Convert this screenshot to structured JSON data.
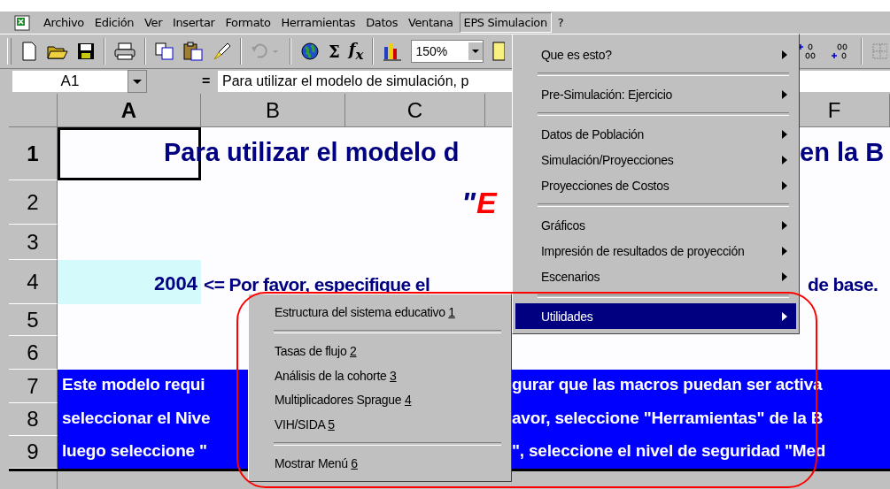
{
  "menu_bar": {
    "items": [
      {
        "label": "Archivo",
        "selected": false
      },
      {
        "label": "Edición",
        "selected": false
      },
      {
        "label": "Ver",
        "selected": false
      },
      {
        "label": "Insertar",
        "selected": false
      },
      {
        "label": "Formato",
        "selected": false
      },
      {
        "label": "Herramientas",
        "selected": false
      },
      {
        "label": "Datos",
        "selected": false
      },
      {
        "label": "Ventana",
        "selected": false
      },
      {
        "label": "EPS Simulacion",
        "selected": true
      },
      {
        "label": "?",
        "selected": false
      }
    ]
  },
  "toolbar": {
    "glyphs": [
      "Σ",
      "f$_{x}$"
    ],
    "zoom": "150%"
  },
  "formula_bar": {
    "name_box": "A1",
    "equals": "=",
    "formula": "Para utilizar el modelo de simulación, p"
  },
  "sheet": {
    "columns": [
      {
        "label": "A",
        "selected": true
      },
      {
        "label": "B",
        "selected": false
      },
      {
        "label": "C",
        "selected": false
      },
      {
        "label": "F",
        "selected": false
      }
    ],
    "rows": [
      {
        "number": "1",
        "selected": true,
        "kind": "title",
        "fragments": [
          {
            "text": "Para utilizar el modelo d",
            "color": "#000080"
          },
          {
            "text": "en la B",
            "color": "#000080"
          }
        ]
      },
      {
        "number": "2",
        "selected": false,
        "kind": "subtitle",
        "fragments": [
          {
            "text": "\"",
            "color": "#000080"
          },
          {
            "text": "E",
            "color": "#ff0000"
          }
        ]
      },
      {
        "number": "3",
        "selected": false,
        "kind": "blank"
      },
      {
        "number": "4",
        "selected": false,
        "kind": "input",
        "value": "2004",
        "fragments": [
          {
            "text": "<= Por favor, especifique el",
            "color": "#000080"
          },
          {
            "text": "de base.",
            "color": "#000080"
          }
        ]
      },
      {
        "number": "5",
        "selected": false,
        "kind": "blank"
      },
      {
        "number": "6",
        "selected": false,
        "kind": "blank"
      },
      {
        "number": "7",
        "selected": false,
        "kind": "banner",
        "fragments": [
          {
            "text": "Este modelo requi",
            "color": "#ffffff"
          },
          {
            "text": "gurar que las macros puedan ser activa",
            "color": "#ffffff"
          }
        ]
      },
      {
        "number": "8",
        "selected": false,
        "kind": "banner",
        "fragments": [
          {
            "text": "seleccionar el Nive",
            "color": "#ffffff"
          },
          {
            "text": "avor, seleccione \"Herramientas\" de la B",
            "color": "#ffffff"
          }
        ]
      },
      {
        "number": "9",
        "selected": false,
        "kind": "banner",
        "fragments": [
          {
            "text": "luego seleccione \"",
            "color": "#ffffff"
          },
          {
            "text": "\", seleccione el nivel de seguridad \"Med",
            "color": "#ffffff"
          }
        ]
      }
    ]
  },
  "menu": {
    "items": [
      {
        "kind": "item",
        "label": "Que es esto?",
        "selected": false
      },
      {
        "kind": "separator"
      },
      {
        "kind": "item",
        "label": "Pre-Simulación: Ejercicio",
        "selected": false
      },
      {
        "kind": "separator"
      },
      {
        "kind": "item",
        "label": "Datos de Población",
        "selected": false
      },
      {
        "kind": "item",
        "label": "Simulación/Proyecciones",
        "selected": false
      },
      {
        "kind": "item",
        "label": "Proyecciones de Costos",
        "selected": false
      },
      {
        "kind": "separator"
      },
      {
        "kind": "item",
        "label": "Gráficos",
        "selected": false
      },
      {
        "kind": "item",
        "label": "Impresión de resultados de proyección",
        "selected": false
      },
      {
        "kind": "item",
        "label": "Escenarios",
        "selected": false
      },
      {
        "kind": "separator"
      },
      {
        "kind": "item",
        "label": "Utilidades",
        "selected": true
      }
    ]
  },
  "submenu": {
    "items": [
      {
        "kind": "item",
        "label": "Estructura del sistema educativo",
        "key": "1"
      },
      {
        "kind": "separator"
      },
      {
        "kind": "item",
        "label": "Tasas de flujo",
        "key": "2"
      },
      {
        "kind": "item",
        "label": "Análisis de la cohorte",
        "key": "3"
      },
      {
        "kind": "item",
        "label": "Multiplicadores Sprague",
        "key": "4"
      },
      {
        "kind": "item",
        "label": "VIH/SIDA",
        "key": "5"
      },
      {
        "kind": "separator"
      },
      {
        "kind": "item",
        "label": "Mostrar Menú",
        "key": "6"
      }
    ]
  }
}
